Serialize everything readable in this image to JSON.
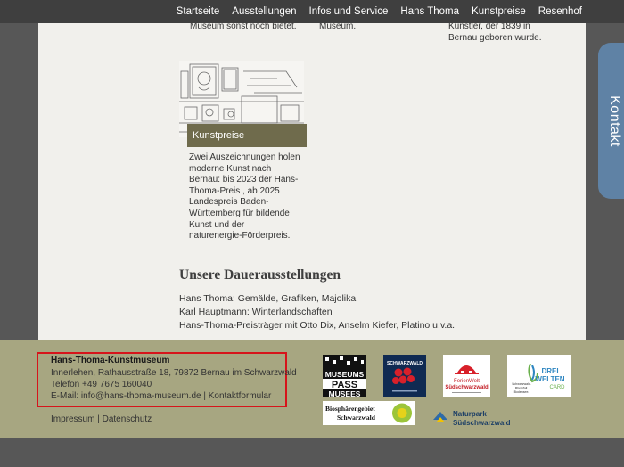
{
  "nav": {
    "items": [
      "Startseite",
      "Ausstellungen",
      "Infos und Service",
      "Hans Thoma",
      "Kunstpreise",
      "Resenhof"
    ]
  },
  "cards": {
    "left_snippet": "Museum sonst noch bietet.",
    "middle_snippet": "Museum.",
    "right_snippet": [
      "Künstler, der 1839 in",
      "Bernau geboren wurde."
    ],
    "kunstpreise": {
      "label": "Kunstpreise",
      "text_lines": [
        "Zwei Auszeichnungen holen",
        "moderne Kunst nach",
        "Bernau: bis 2023 der Hans-",
        "Thoma-Preis , ab 2025",
        "Landespreis Baden-",
        "Württemberg für bildende",
        "Kunst und der",
        "naturenergie-Förderpreis."
      ]
    }
  },
  "dauerausstellungen": {
    "title": "Unsere Dauerausstellungen",
    "items": [
      "Hans Thoma: Gemälde, Grafiken, Majolika",
      "Karl Hauptmann: Winterlandschaften",
      "Hans-Thoma-Preisträger mit Otto Dix, Anselm Kiefer, Platino u.v.a."
    ]
  },
  "kontakt_tab": "Kontakt",
  "footer": {
    "name": "Hans-Thoma-Kunstmuseum",
    "address": "Innerlehen, Rathausstraße 18, 79872 Bernau im Schwarzwald",
    "phone": "Telefon +49 7675 160040",
    "email_prefix": "E-Mail: ",
    "email": "info@hans-thoma-museum.de",
    "separator": " | ",
    "contact_form": "Kontaktformular",
    "impressum": "Impressum",
    "datenschutz": "Datenschutz"
  },
  "logos": {
    "museumspass": [
      "MUSEUMS",
      "PASS",
      "MUSEES"
    ],
    "schwarzwald": "SCHWARZWALD",
    "ferienwelt": [
      "FerienWelt",
      "Südschwarzwald"
    ],
    "dreiwelten": [
      "DREI",
      "WELTEN",
      "CARD"
    ],
    "dreiwelten_sub": [
      "Schwarzwald.",
      "Rheinfall.",
      "Bodensee."
    ],
    "biosphaere": [
      "Biosphärengebiet",
      "Schwarzwald"
    ],
    "naturpark": [
      "Naturpark",
      "Südschwarzwald"
    ]
  },
  "colors": {
    "nav_bg": "#3f3f3f",
    "footer_bg": "#a7a681",
    "caption_bg": "#6f6b4c",
    "kontakt_bg": "#5f82a5",
    "highlight_border": "#d6141b"
  }
}
